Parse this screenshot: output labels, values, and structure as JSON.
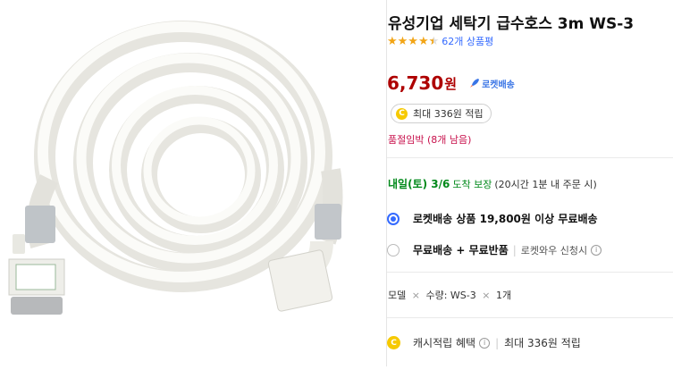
{
  "product": {
    "title": "유성기업 세탁기 급수호스 3m WS-3",
    "rating_stars": 4.5,
    "review_count": "62개 상품평",
    "price": "6,730",
    "currency": "원",
    "rocket_label": "로켓배송",
    "cash_pill": "최대 336원 적립",
    "coin_letter": "C",
    "stock_notice": "품절임박 (8개 남음)"
  },
  "delivery": {
    "date": "내일(토) 3/6",
    "guarantee": "도착 보장",
    "cutoff": "(20시간 1분 내 주문 시)"
  },
  "options": [
    {
      "label": "로켓배송 상품 19,800원 이상 무료배송",
      "selected": true
    },
    {
      "label": "무료배송 + 무료반품",
      "sub": "로켓와우 신청시",
      "selected": false
    }
  ],
  "model": {
    "label": "모델",
    "times1": "×",
    "qty_label": "수량:",
    "value": "WS-3",
    "times2": "×",
    "qty": "1개"
  },
  "cash": {
    "label": "캐시적립 혜택",
    "amount": "최대 336원 적립"
  },
  "colors": {
    "price": "#ae0000",
    "accent": "#346aff",
    "delivery": "#00891a",
    "stock": "#c8114c",
    "star": "#f2a516"
  }
}
